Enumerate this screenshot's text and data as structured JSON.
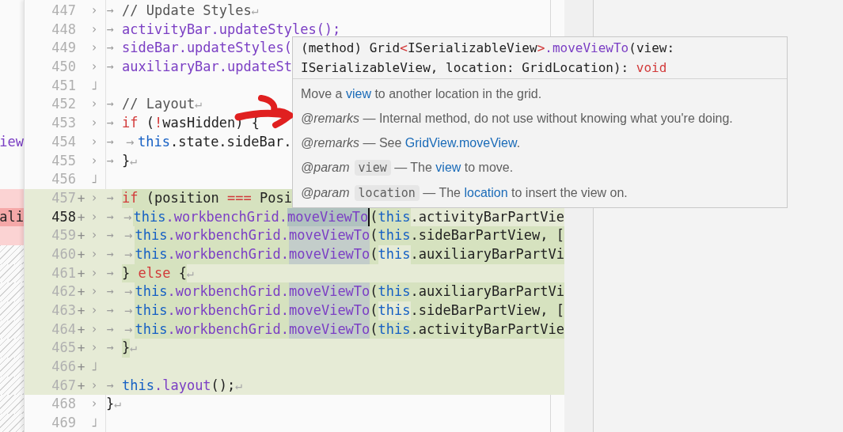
{
  "left_pane": [
    {
      "kind": "blank"
    },
    {
      "kind": "blank"
    },
    {
      "kind": "blank"
    },
    {
      "kind": "blank"
    },
    {
      "kind": "blank"
    },
    {
      "kind": "blank"
    },
    {
      "kind": "blank"
    },
    {
      "kind": "blank",
      "text": "iew"
    },
    {
      "kind": "blank"
    },
    {
      "kind": "blank"
    },
    {
      "kind": "removed"
    },
    {
      "kind": "removed_current",
      "text": "ali"
    },
    {
      "kind": "removed"
    },
    {
      "kind": "filler"
    },
    {
      "kind": "filler"
    },
    {
      "kind": "filler"
    },
    {
      "kind": "filler"
    },
    {
      "kind": "filler"
    },
    {
      "kind": "filler"
    },
    {
      "kind": "filler"
    },
    {
      "kind": "filler"
    },
    {
      "kind": "filler"
    },
    {
      "kind": "filler"
    }
  ],
  "lines": [
    {
      "n": "447",
      "added": false,
      "current": false,
      "gutter": [
        "›",
        "→"
      ],
      "tokens": [
        {
          "kind": "comment",
          "text": "// Update Styles"
        },
        {
          "kind": "eol",
          "text": "↵"
        }
      ]
    },
    {
      "n": "448",
      "added": false,
      "current": false,
      "gutter": [
        "›",
        "→"
      ],
      "tokens": [
        {
          "kind": "ident",
          "text": "activityBar.updateStyles();"
        }
      ]
    },
    {
      "n": "449",
      "added": false,
      "current": false,
      "gutter": [
        "›",
        "→"
      ],
      "tokens": [
        {
          "kind": "ident",
          "text": "sideBar.updateStyles("
        }
      ]
    },
    {
      "n": "450",
      "added": false,
      "current": false,
      "gutter": [
        "›",
        "→"
      ],
      "tokens": [
        {
          "kind": "ident",
          "text": "auxiliaryBar.updateSt"
        }
      ]
    },
    {
      "n": "451",
      "added": false,
      "current": false,
      "gutter": [
        "˩"
      ]
    },
    {
      "n": "452",
      "added": false,
      "current": false,
      "gutter": [
        "›",
        "→"
      ],
      "tokens": [
        {
          "kind": "comment",
          "text": "// Layout"
        },
        {
          "kind": "eol",
          "text": "↵"
        }
      ]
    },
    {
      "n": "453",
      "added": false,
      "current": false,
      "gutter": [
        "›",
        "→"
      ],
      "tokens": [
        {
          "kind": "keyword",
          "text": "if"
        },
        {
          "kind": "plain",
          "text": " ("
        },
        {
          "kind": "keyword",
          "text": "!"
        },
        {
          "kind": "plain",
          "text": "wasHidden) {"
        }
      ]
    },
    {
      "n": "454",
      "added": false,
      "current": false,
      "gutter": [
        "›",
        "→"
      ],
      "tokens": [
        {
          "kind": "tab",
          "text": "→"
        },
        {
          "kind": "this",
          "text": "this"
        },
        {
          "kind": "plain",
          "text": ".state.sideBar."
        }
      ]
    },
    {
      "n": "455",
      "added": false,
      "current": false,
      "gutter": [
        "›",
        "→"
      ],
      "tokens": [
        {
          "kind": "plain",
          "text": "}"
        },
        {
          "kind": "eol",
          "text": "↵"
        }
      ]
    },
    {
      "n": "456",
      "added": false,
      "current": false,
      "gutter": [
        "˩"
      ]
    },
    {
      "n": "457",
      "added": true,
      "marker": "+",
      "current": false,
      "gutter": [
        "›",
        "→"
      ],
      "tokens": [
        {
          "kind": "keyword",
          "text": "if",
          "diff": true
        },
        {
          "kind": "plain",
          "text": " (position ",
          "diff": true
        },
        {
          "kind": "keyword",
          "text": "===",
          "diff": true
        },
        {
          "kind": "plain",
          "text": " Posi",
          "diff": true
        }
      ]
    },
    {
      "n": "458",
      "added": true,
      "marker": "+",
      "current": true,
      "gutter": [
        "›",
        "→"
      ],
      "tokens": [
        {
          "kind": "tab",
          "text": "→"
        },
        {
          "kind": "this",
          "text": "this",
          "diff": true
        },
        {
          "kind": "ident",
          "text": ".workbenchGrid.",
          "diff": true
        },
        {
          "kind": "ident",
          "text": "moveViewTo",
          "occurrence": true,
          "current": true
        },
        {
          "kind": "plain",
          "text": "(",
          "diff": true,
          "caret": true
        },
        {
          "kind": "this",
          "text": "this",
          "diff": true
        },
        {
          "kind": "plain",
          "text": ".activityBarPartVie"
        }
      ]
    },
    {
      "n": "459",
      "added": true,
      "marker": "+",
      "current": false,
      "gutter": [
        "›",
        "→"
      ],
      "tokens": [
        {
          "kind": "tab",
          "text": "→"
        },
        {
          "kind": "this",
          "text": "this",
          "diff": true
        },
        {
          "kind": "ident",
          "text": ".workbenchGrid.",
          "diff": true
        },
        {
          "kind": "ident",
          "text": "moveViewTo",
          "occurrence": true,
          "current": false
        },
        {
          "kind": "plain",
          "text": "(",
          "diff": true
        },
        {
          "kind": "this",
          "text": "this",
          "diff": true
        },
        {
          "kind": "plain",
          "text": ".sideBarPartView, [",
          "diff": true
        }
      ]
    },
    {
      "n": "460",
      "added": true,
      "marker": "+",
      "current": false,
      "gutter": [
        "›",
        "→"
      ],
      "tokens": [
        {
          "kind": "tab",
          "text": "→"
        },
        {
          "kind": "this",
          "text": "this",
          "diff": true
        },
        {
          "kind": "ident",
          "text": ".workbenchGrid.",
          "diff": true
        },
        {
          "kind": "ident",
          "text": "moveViewTo",
          "occurrence": true,
          "current": false
        },
        {
          "kind": "plain",
          "text": "(",
          "diff": true
        },
        {
          "kind": "this",
          "text": "this"
        },
        {
          "kind": "plain",
          "text": ".auxiliaryBarPartVi",
          "diff": true
        }
      ]
    },
    {
      "n": "461",
      "added": true,
      "marker": "+",
      "current": false,
      "gutter": [
        "›",
        "→"
      ],
      "tokens": [
        {
          "kind": "plain",
          "text": "} ",
          "diff": true
        },
        {
          "kind": "keyword",
          "text": "else",
          "diff": true
        },
        {
          "kind": "plain",
          "text": " {",
          "diff": true
        },
        {
          "kind": "eol",
          "text": "↵"
        }
      ]
    },
    {
      "n": "462",
      "added": true,
      "marker": "+",
      "current": false,
      "gutter": [
        "›",
        "→"
      ],
      "tokens": [
        {
          "kind": "tab",
          "text": "→"
        },
        {
          "kind": "this",
          "text": "this",
          "diff": true
        },
        {
          "kind": "ident",
          "text": ".workbenchGrid.",
          "diff": true
        },
        {
          "kind": "ident",
          "text": "moveViewTo",
          "occurrence": true,
          "current": false
        },
        {
          "kind": "plain",
          "text": "(",
          "diff": true
        },
        {
          "kind": "this",
          "text": "this",
          "diff": true
        },
        {
          "kind": "plain",
          "text": ".auxiliaryBarPartVi",
          "diff": true
        }
      ]
    },
    {
      "n": "463",
      "added": true,
      "marker": "+",
      "current": false,
      "gutter": [
        "›",
        "→"
      ],
      "tokens": [
        {
          "kind": "tab",
          "text": "→"
        },
        {
          "kind": "this",
          "text": "this",
          "diff": true
        },
        {
          "kind": "ident",
          "text": ".workbenchGrid.",
          "diff": true
        },
        {
          "kind": "ident",
          "text": "moveViewTo",
          "occurrence": true,
          "current": false
        },
        {
          "kind": "plain",
          "text": "(",
          "diff": true
        },
        {
          "kind": "this",
          "text": "this"
        },
        {
          "kind": "plain",
          "text": ".sideBarPartView, [",
          "diff": true
        }
      ]
    },
    {
      "n": "464",
      "added": true,
      "marker": "+",
      "current": false,
      "gutter": [
        "›",
        "→"
      ],
      "tokens": [
        {
          "kind": "tab",
          "text": "→"
        },
        {
          "kind": "this",
          "text": "this",
          "diff": true
        },
        {
          "kind": "ident",
          "text": ".workbenchGrid.",
          "diff": true
        },
        {
          "kind": "ident",
          "text": "moveViewTo",
          "occurrence": true,
          "current": false
        },
        {
          "kind": "plain",
          "text": "(",
          "diff": true
        },
        {
          "kind": "this",
          "text": "this",
          "diff": true
        },
        {
          "kind": "plain",
          "text": ".activityBarPartVie",
          "diff": true
        }
      ]
    },
    {
      "n": "465",
      "added": true,
      "marker": "+",
      "current": false,
      "gutter": [
        "›",
        "→"
      ],
      "tokens": [
        {
          "kind": "plain",
          "text": "}",
          "diff": true
        },
        {
          "kind": "eol",
          "text": "↵"
        }
      ]
    },
    {
      "n": "466",
      "added": true,
      "marker": "+",
      "current": false,
      "gutter": [
        "˩"
      ]
    },
    {
      "n": "467",
      "added": true,
      "marker": "+",
      "current": false,
      "gutter": [
        "›",
        "→"
      ],
      "tokens": [
        {
          "kind": "this",
          "text": "this"
        },
        {
          "kind": "ident",
          "text": ".layout"
        },
        {
          "kind": "plain",
          "text": "();"
        },
        {
          "kind": "eol",
          "text": "↵"
        }
      ]
    },
    {
      "n": "468",
      "added": false,
      "current": false,
      "gutter": [
        "›"
      ],
      "tokens": [
        {
          "kind": "plain",
          "text": "}"
        },
        {
          "kind": "eol",
          "text": "↵"
        }
      ]
    },
    {
      "n": "469",
      "added": false,
      "current": false,
      "gutter": [
        "˩"
      ]
    }
  ],
  "tooltip": {
    "signature": [
      [
        {
          "kind": "plain",
          "text": "(method) Grid"
        },
        {
          "kind": "keyword",
          "text": "<"
        },
        {
          "kind": "plain",
          "text": "ISerializableView"
        },
        {
          "kind": "keyword",
          "text": ">"
        },
        {
          "kind": "ident",
          "text": ".moveViewTo"
        },
        {
          "kind": "plain",
          "text": "(view:"
        }
      ],
      [
        {
          "kind": "plain",
          "text": "ISerializableView, location: GridLocation): "
        },
        {
          "kind": "keyword",
          "text": "void"
        }
      ]
    ],
    "paragraphs": [
      [
        {
          "kind": "text",
          "text": "Move a "
        },
        {
          "kind": "link",
          "text": "view"
        },
        {
          "kind": "text",
          "text": " to another location in the grid."
        }
      ],
      [
        {
          "kind": "tag",
          "text": "@remarks"
        },
        {
          "kind": "text",
          "text": " — Internal method, do not use without knowing what you're doing."
        }
      ],
      [
        {
          "kind": "tag",
          "text": "@remarks"
        },
        {
          "kind": "text",
          "text": " — See "
        },
        {
          "kind": "link",
          "text": "GridView.moveView"
        },
        {
          "kind": "text",
          "text": "."
        }
      ],
      [
        {
          "kind": "tag",
          "text": "@param"
        },
        {
          "kind": "code",
          "text": "view"
        },
        {
          "kind": "text",
          "text": " — The "
        },
        {
          "kind": "link",
          "text": "view"
        },
        {
          "kind": "text",
          "text": " to move."
        }
      ],
      [
        {
          "kind": "tag",
          "text": "@param"
        },
        {
          "kind": "code",
          "text": "location"
        },
        {
          "kind": "text",
          "text": " — The "
        },
        {
          "kind": "link",
          "text": "location"
        },
        {
          "kind": "text",
          "text": " to insert the view on."
        }
      ]
    ]
  }
}
